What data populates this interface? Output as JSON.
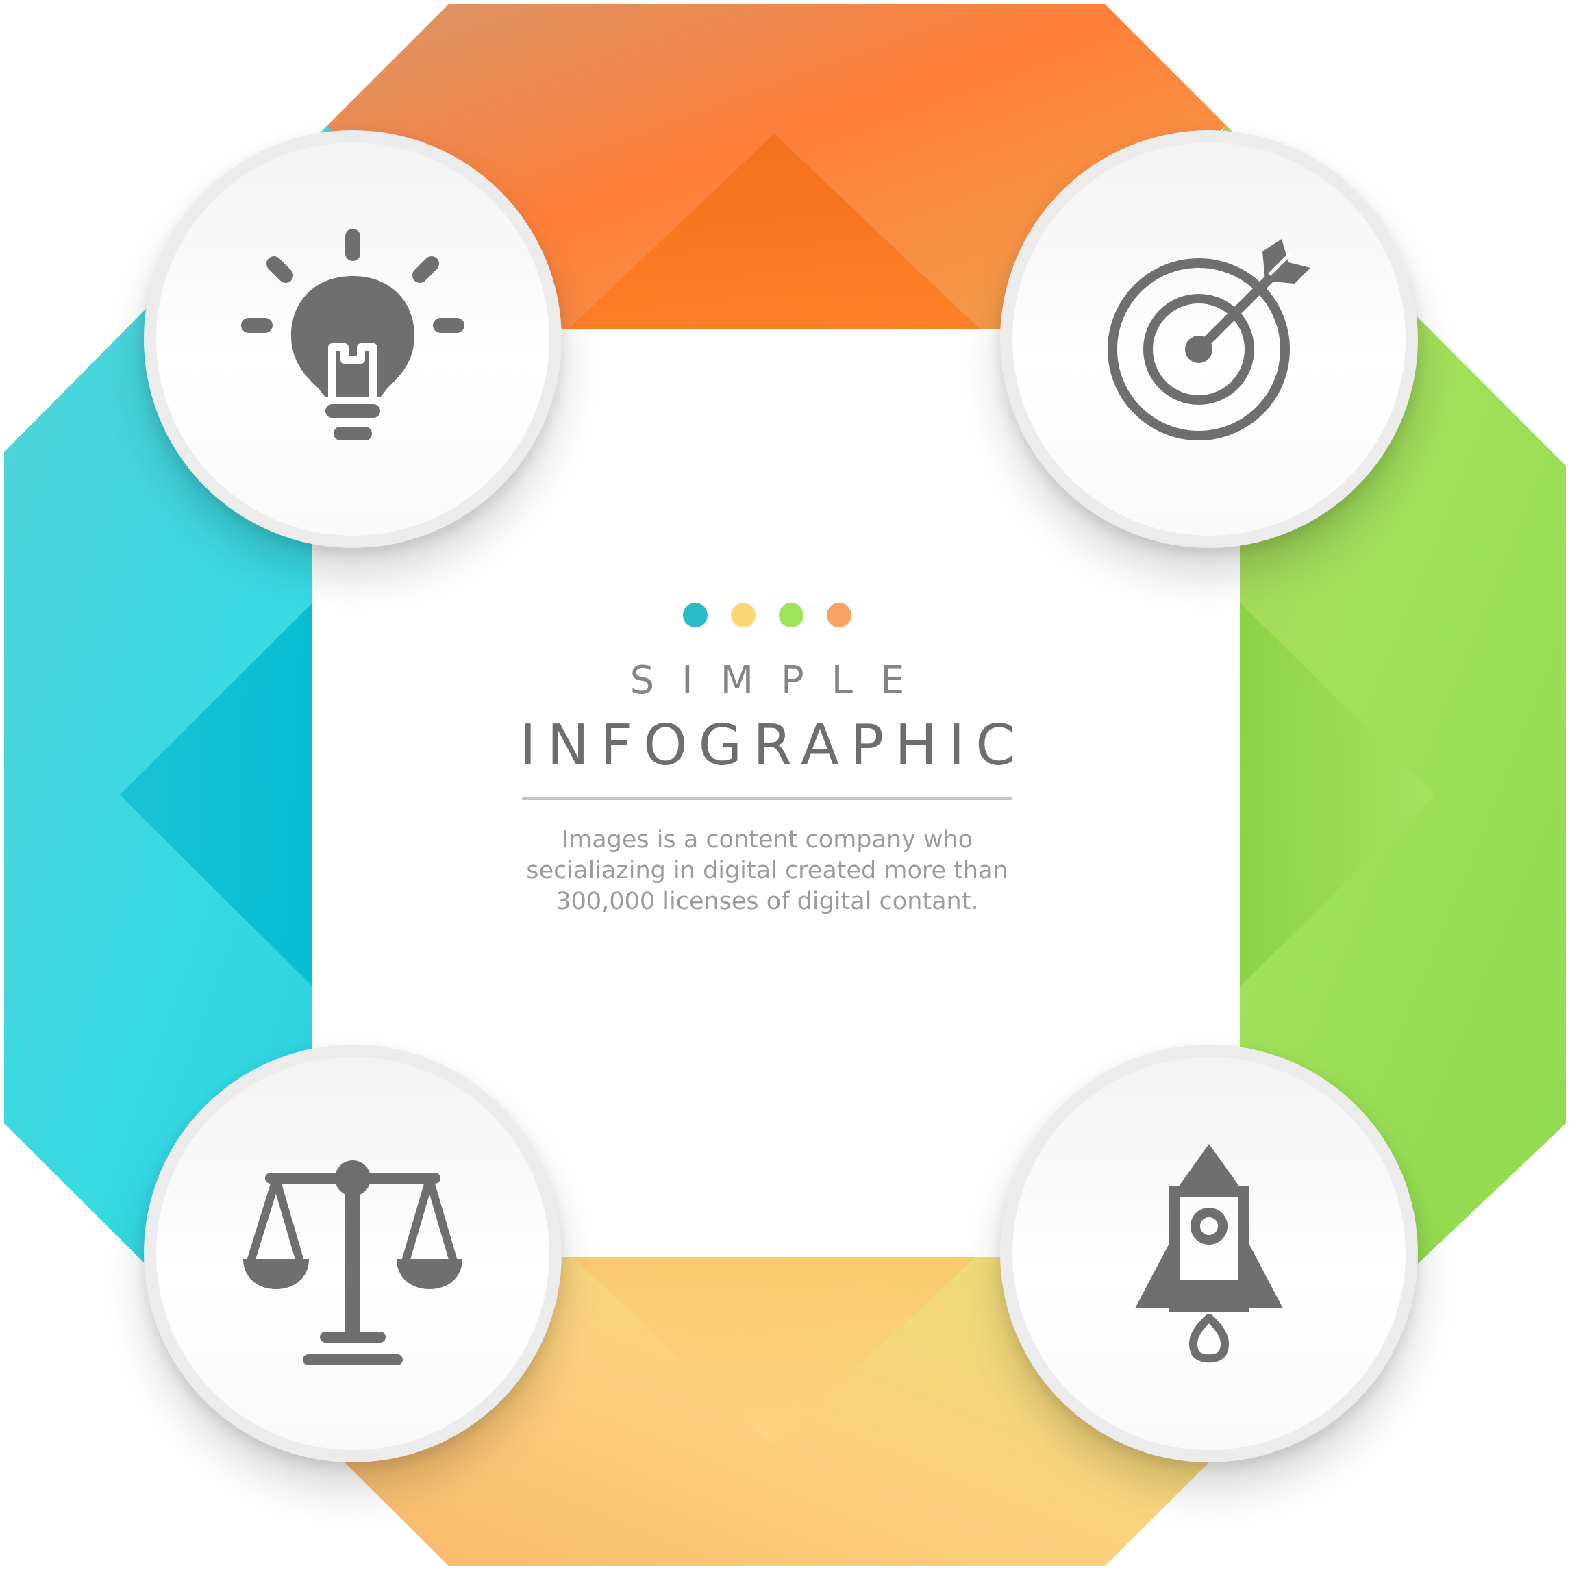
{
  "header": {
    "title_small": "SIMPLE",
    "title_big": "INFOGRAPHIC",
    "description": "Images is a content company who secialiazing in digital created more than 300,000 licenses of digital contant."
  },
  "dots": [
    {
      "color": "#2bbcc7"
    },
    {
      "color": "#fcd77a"
    },
    {
      "color": "#9ee35a"
    },
    {
      "color": "#f9a465"
    }
  ],
  "nodes": [
    {
      "icon": "lightbulb-icon",
      "band_color": "#2cc6d6"
    },
    {
      "icon": "target-arrow-icon",
      "band_color": "#ff7a1f"
    },
    {
      "icon": "balance-scale-icon",
      "band_color": "#fbc56a"
    },
    {
      "icon": "rocket-icon",
      "band_color": "#8ed94a"
    }
  ],
  "colors": {
    "icon": "#6f6f6f",
    "orange": "#ff7a1f",
    "green": "#8ed94a",
    "yellow": "#fbc56a",
    "cyan": "#2cc6d6"
  }
}
